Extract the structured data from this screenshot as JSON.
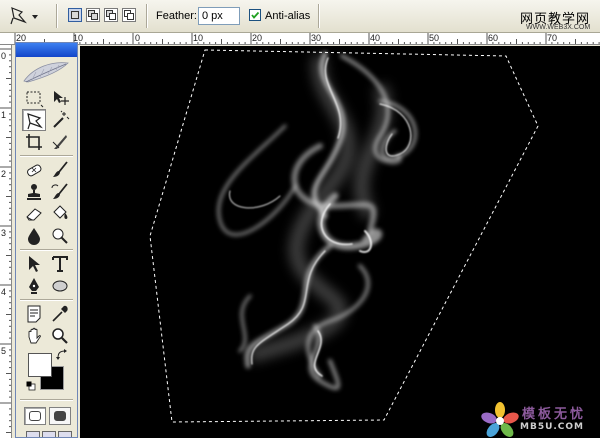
{
  "options_bar": {
    "tool_icon": "polygonal-lasso-icon",
    "feather_label": "Feather:",
    "feather_value": "0 px",
    "antialias_label": "Anti-alias",
    "antialias_checked": true,
    "selection_modes": [
      "new-selection",
      "add-to-selection",
      "subtract-from-selection",
      "intersect-with-selection"
    ]
  },
  "watermark": {
    "title": "网页教学网",
    "url": "WWW.WEB3X.COM"
  },
  "rulers": {
    "top_labels": [
      "20",
      "10",
      "0",
      "10",
      "20",
      "30",
      "40",
      "50",
      "60",
      "70"
    ],
    "left_labels": [
      "0",
      "1",
      "2",
      "3",
      "4",
      "5"
    ]
  },
  "toolbox": {
    "tools": [
      "rectangular-marquee-icon",
      "move-icon",
      "polygonal-lasso-icon",
      "magic-wand-icon",
      "crop-icon",
      "slice-icon",
      "healing-brush-icon",
      "brush-icon",
      "clone-stamp-icon",
      "history-brush-icon",
      "eraser-icon",
      "paint-bucket-icon",
      "blur-icon",
      "dodge-icon",
      "path-selection-icon",
      "type-icon",
      "pen-icon",
      "ellipse-shape-icon",
      "notes-icon",
      "eyedropper-icon",
      "hand-icon",
      "zoom-icon"
    ],
    "active_tool": "polygonal-lasso-icon",
    "foreground_color": "#ffffff",
    "background_color": "#000000"
  },
  "logo": {
    "text": "模板无忧",
    "url": "MB5U.COM"
  }
}
